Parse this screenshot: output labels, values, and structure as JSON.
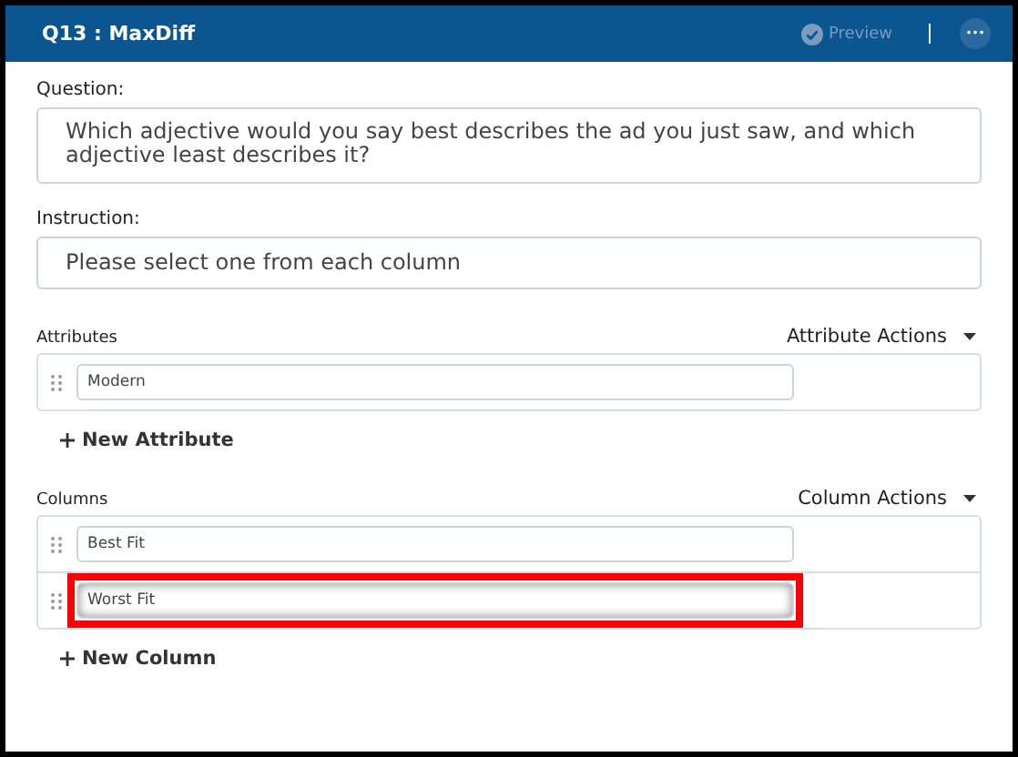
{
  "header": {
    "title": "Q13 : MaxDiff",
    "preview": "Preview",
    "more": "•••"
  },
  "question": {
    "label": "Question:",
    "value": "Which adjective would you say best describes the ad you just saw, and which adjective least describes it?"
  },
  "instruction": {
    "label": "Instruction:",
    "value": "Please select one from each column"
  },
  "sections": [
    {
      "label": "Attributes",
      "actions": "Attribute Actions",
      "items": [
        {
          "value": "Modern",
          "highlighted": false
        }
      ],
      "add": "New Attribute"
    },
    {
      "label": "Columns",
      "actions": "Column Actions",
      "items": [
        {
          "value": "Best Fit",
          "highlighted": false
        },
        {
          "value": "Worst Fit",
          "highlighted": true
        }
      ],
      "add": "New Column"
    }
  ]
}
